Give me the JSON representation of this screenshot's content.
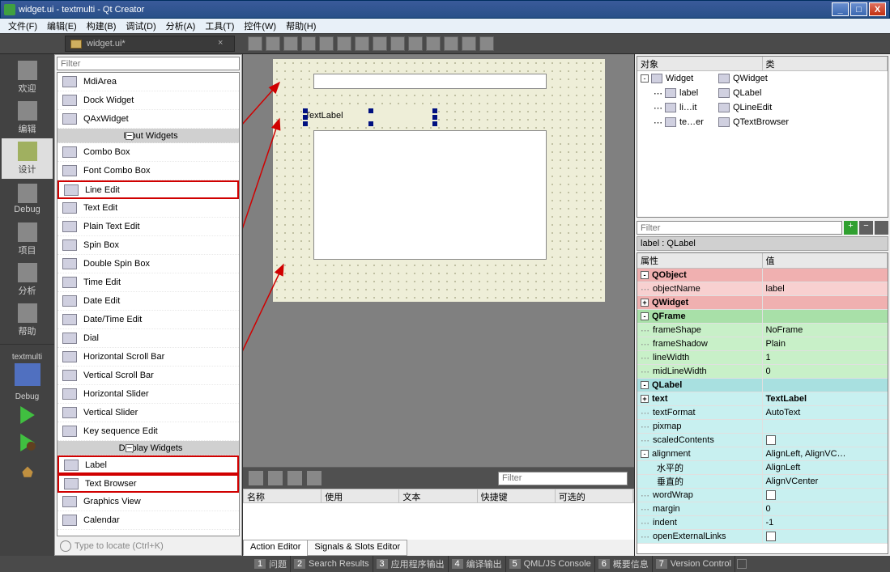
{
  "title": "widget.ui - textmulti - Qt Creator",
  "menu": [
    "文件(F)",
    "编辑(E)",
    "构建(B)",
    "调试(D)",
    "分析(A)",
    "工具(T)",
    "控件(W)",
    "帮助(H)"
  ],
  "tabfile": "widget.ui*",
  "leftbar": {
    "modes": [
      {
        "label": "欢迎"
      },
      {
        "label": "编辑"
      },
      {
        "label": "设计",
        "active": true
      },
      {
        "label": "Debug"
      },
      {
        "label": "项目"
      },
      {
        "label": "分析"
      },
      {
        "label": "帮助"
      }
    ],
    "kit_label": "textmulti",
    "run_label": "Debug"
  },
  "widgetbox": {
    "filter_placeholder": "Filter",
    "groups": [
      {
        "header": null,
        "items": [
          "MdiArea",
          "Dock Widget",
          "QAxWidget"
        ]
      },
      {
        "header": "Input Widgets",
        "items": [
          "Combo Box",
          "Font Combo Box",
          "Line Edit",
          "Text Edit",
          "Plain Text Edit",
          "Spin Box",
          "Double Spin Box",
          "Time Edit",
          "Date Edit",
          "Date/Time Edit",
          "Dial",
          "Horizontal Scroll Bar",
          "Vertical Scroll Bar",
          "Horizontal Slider",
          "Vertical Slider",
          "Key sequence Edit"
        ]
      },
      {
        "header": "Display Widgets",
        "items": [
          "Label",
          "Text Browser",
          "Graphics View",
          "Calendar"
        ]
      }
    ],
    "highlight": [
      "Line Edit",
      "Label",
      "Text Browser"
    ],
    "locator_placeholder": "Type to locate (Ctrl+K)"
  },
  "canvas": {
    "textlabel": "TextLabel"
  },
  "actioneditor": {
    "filter_placeholder": "Filter",
    "columns": [
      "名称",
      "使用",
      "文本",
      "快捷键",
      "可选的"
    ],
    "tabs": [
      "Action Editor",
      "Signals & Slots Editor"
    ]
  },
  "objtree": {
    "headers": [
      "对象",
      "类"
    ],
    "rows": [
      {
        "indent": 0,
        "exp": "-",
        "name": "Widget",
        "cls": "QWidget"
      },
      {
        "indent": 1,
        "name": "label",
        "cls": "QLabel"
      },
      {
        "indent": 1,
        "name": "li…it",
        "cls": "QLineEdit"
      },
      {
        "indent": 1,
        "name": "te…er",
        "cls": "QTextBrowser"
      }
    ]
  },
  "props": {
    "filter_placeholder": "Filter",
    "object_label": "label : QLabel",
    "headers": [
      "属性",
      "值"
    ],
    "rows": [
      {
        "type": "grp",
        "name": "QObject",
        "cls": "c-pink2",
        "exp": "-"
      },
      {
        "name": "objectName",
        "val": "label",
        "cls": "c-pink",
        "dots": 1
      },
      {
        "type": "grp",
        "name": "QWidget",
        "cls": "c-pink2",
        "exp": "+"
      },
      {
        "type": "grp",
        "name": "QFrame",
        "cls": "c-green2",
        "exp": "-"
      },
      {
        "name": "frameShape",
        "val": "NoFrame",
        "cls": "c-green",
        "dots": 1
      },
      {
        "name": "frameShadow",
        "val": "Plain",
        "cls": "c-green",
        "dots": 1
      },
      {
        "name": "lineWidth",
        "val": "1",
        "cls": "c-green",
        "dots": 1
      },
      {
        "name": "midLineWidth",
        "val": "0",
        "cls": "c-green",
        "dots": 1
      },
      {
        "type": "grp",
        "name": "QLabel",
        "cls": "c-cyan2",
        "exp": "-"
      },
      {
        "name": "text",
        "val": "TextLabel",
        "cls": "c-cyan",
        "exp": "+",
        "bold": 1
      },
      {
        "name": "textFormat",
        "val": "AutoText",
        "cls": "c-cyan",
        "dots": 1
      },
      {
        "name": "pixmap",
        "val": "",
        "cls": "c-cyan",
        "dots": 1
      },
      {
        "name": "scaledContents",
        "val": "[chk]",
        "cls": "c-cyan",
        "dots": 1
      },
      {
        "name": "alignment",
        "val": "AlignLeft, AlignVC…",
        "cls": "c-cyan",
        "exp": "-"
      },
      {
        "name": "水平的",
        "val": "AlignLeft",
        "cls": "c-cyan",
        "indent": 1
      },
      {
        "name": "垂直的",
        "val": "AlignVCenter",
        "cls": "c-cyan",
        "indent": 1
      },
      {
        "name": "wordWrap",
        "val": "[chk]",
        "cls": "c-cyan",
        "dots": 1
      },
      {
        "name": "margin",
        "val": "0",
        "cls": "c-cyan",
        "dots": 1
      },
      {
        "name": "indent",
        "val": "-1",
        "cls": "c-cyan",
        "dots": 1
      },
      {
        "name": "openExternalLinks",
        "val": "[chk]",
        "cls": "c-cyan",
        "dots": 1
      }
    ]
  },
  "bottombar": [
    {
      "n": "1",
      "t": "问题"
    },
    {
      "n": "2",
      "t": "Search Results"
    },
    {
      "n": "3",
      "t": "应用程序输出"
    },
    {
      "n": "4",
      "t": "编译输出"
    },
    {
      "n": "5",
      "t": "QML/JS Console"
    },
    {
      "n": "6",
      "t": "概要信息"
    },
    {
      "n": "7",
      "t": "Version Control"
    }
  ]
}
